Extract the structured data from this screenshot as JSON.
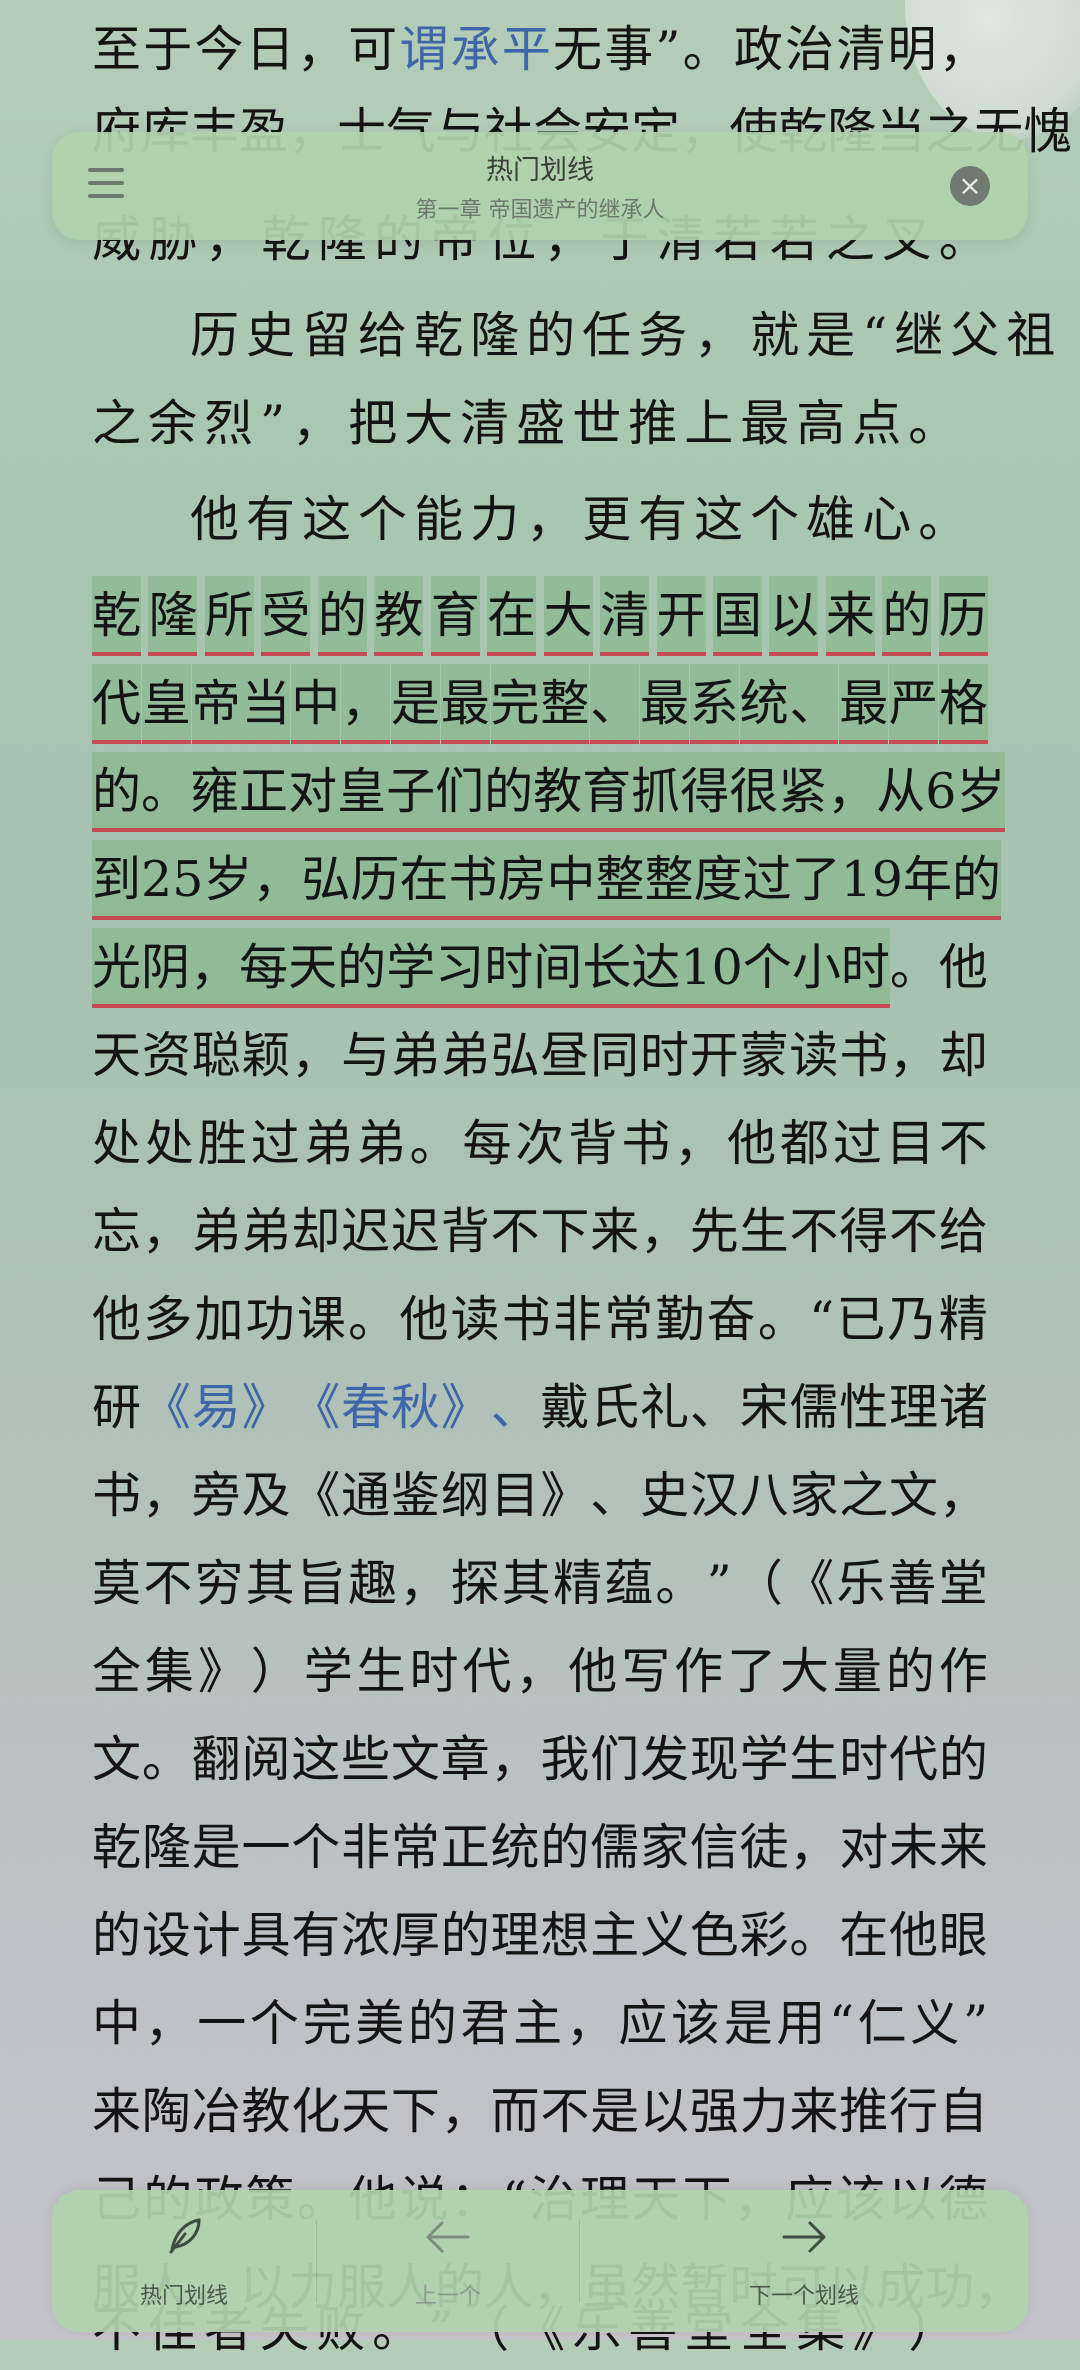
{
  "header": {
    "title": "热门划线",
    "subtitle": "第一章 帝国遗产的继承人"
  },
  "footer": {
    "hot_label": "热门划线",
    "prev_label": "上一个",
    "next_label": "下一个划线"
  },
  "text_lines": [
    {
      "text": "至于今日，可谓承平无事”。政治清明，",
      "link": [
        6,
        8
      ]
    },
    {
      "text": "府库丰盈，士气与社会安定，使乾隆当之无愧"
    },
    {
      "text": "威胁，乾隆的帝位，于清若若之叉。"
    },
    {
      "text": "历史留给乾隆的任务，就是“继父祖",
      "indent": true
    },
    {
      "text": "之余烈”，把大清盛世推上最高点。",
      "last": true
    },
    {
      "text": "他有这个能力，更有这个雄心。",
      "indent": true
    },
    {
      "text": "乾隆所受的教育在大清开国以来的历",
      "hl": [
        0,
        16
      ],
      "hl_start_offset": 1
    },
    {
      "text": "代皇帝当中，是最完整、最系统、最严格",
      "hl": [
        0,
        18
      ]
    },
    {
      "text": "的。雍正对皇子们的教育抓得很紧，从6岁",
      "hl": [
        0,
        19
      ]
    },
    {
      "text": "到25岁，弘历在书房中整整度过了19年的",
      "hl": [
        0,
        20
      ]
    },
    {
      "text": "光阴，每天的学习时间长达10个小时。他",
      "hl": [
        0,
        16
      ]
    },
    {
      "text": "天资聪颖，与弟弟弘昼同时开蒙读书，却"
    },
    {
      "text": "处处胜过弟弟。每次背书，他都过目不"
    },
    {
      "text": "忘，弟弟却迟迟背不下来，先生不得不给"
    },
    {
      "text": "他多加功课。他读书非常勤奋。“已乃精"
    },
    {
      "text": "研《易》《春秋》、戴氏礼、宋儒性理诸",
      "link": [
        1,
        8
      ]
    },
    {
      "text": "书，旁及《通鉴纲目》、史汉八家之文，"
    },
    {
      "text": "莫不穷其旨趣，探其精蕴。”（《乐善堂"
    },
    {
      "text": "全集》）学生时代，他写作了大量的作"
    },
    {
      "text": "文。翻阅这些文章，我们发现学生时代的"
    },
    {
      "text": "乾隆是一个非常正统的儒家信徒，对未来"
    },
    {
      "text": "的设计具有浓厚的理想主义色彩。在他眼"
    },
    {
      "text": "中，一个完美的君主，应该是用“仁义”"
    },
    {
      "text": "来陶冶教化天下，而不是以强力来推行自"
    },
    {
      "text": "己的政策。他说：“治理天下，应该以德"
    },
    {
      "text": "服人，以力服人的人，虽然暂时可以成功，"
    },
    {
      "text": "不佳者失败。”（《乐善堂全集》）",
      "last": true
    }
  ]
}
